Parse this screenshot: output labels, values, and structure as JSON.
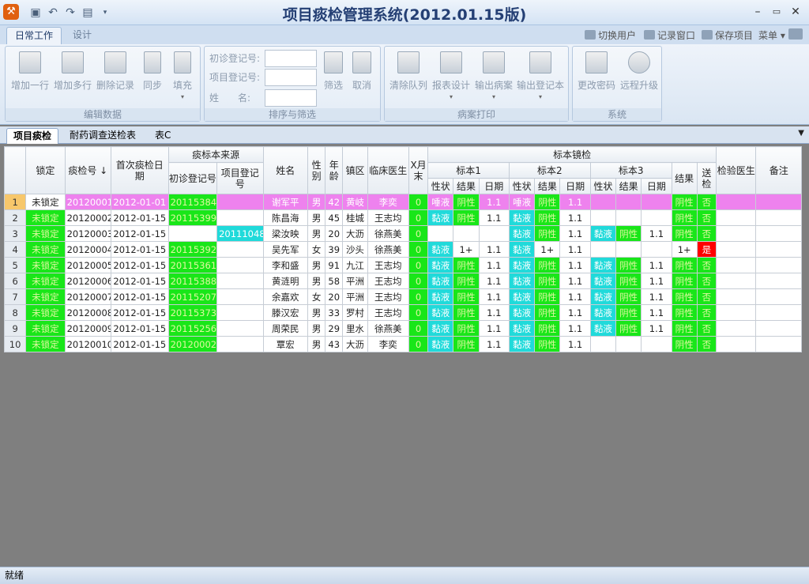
{
  "window": {
    "title": "项目痰检管理系统(2012.01.15版)",
    "app_icon": "tool-icon"
  },
  "ribbon": {
    "tabs": [
      "日常工作",
      "设计"
    ],
    "right_links": [
      "切换用户",
      "记录窗口",
      "保存项目",
      "菜单"
    ],
    "groups": {
      "edit": {
        "title": "编辑数据",
        "buttons": [
          "增加一行",
          "增加多行",
          "删除记录",
          "同步",
          "填充"
        ]
      },
      "filter": {
        "title": "排序与筛选",
        "fields": [
          "初诊登记号:",
          "项目登记号:",
          "姓　　名:"
        ],
        "buttons": [
          "筛选",
          "取消"
        ]
      },
      "print": {
        "title": "病案打印",
        "buttons": [
          "清除队列",
          "报表设计",
          "输出病案",
          "输出登记本"
        ]
      },
      "system": {
        "title": "系统",
        "buttons": [
          "更改密码",
          "远程升级"
        ]
      }
    }
  },
  "doc_tabs": [
    "项目痰检",
    "耐药调查送检表",
    "表C"
  ],
  "grid": {
    "headers": {
      "lock": "锁定",
      "id": "痰检号 ↓",
      "first_date": "首次痰检日期",
      "source": "痰标本来源",
      "src_init": "初诊登记号",
      "src_proj": "项目登记号",
      "name": "姓名",
      "sex": "性别",
      "age": "年龄",
      "town": "镇区",
      "doctor": "临床医生",
      "xray": "X月末",
      "micro": "标本镜检",
      "s1": "标本1",
      "s2": "标本2",
      "s3": "标本3",
      "trait": "性状",
      "result": "结果",
      "date": "日期",
      "final": "结果",
      "send": "送检",
      "lab_doc": "检验医生",
      "note": "备注"
    },
    "rows": [
      {
        "n": "1",
        "lock": "未锁定",
        "id": "20120001",
        "date": "2012-01-01",
        "init": "20115384",
        "proj": "",
        "name": "谢军平",
        "sex": "男",
        "age": "42",
        "town": "黄岐",
        "doctor": "李奕",
        "x": "0",
        "s1": [
          "唾液",
          "阴性",
          "1.1"
        ],
        "s2": [
          "唾液",
          "阴性",
          "1.1"
        ],
        "s3": [
          "",
          "",
          ""
        ],
        "res": "阴性",
        "send": "否"
      },
      {
        "n": "2",
        "lock": "未锁定",
        "id": "20120002",
        "date": "2012-01-15",
        "init": "20115399",
        "proj": "",
        "name": "陈昌海",
        "sex": "男",
        "age": "45",
        "town": "桂城",
        "doctor": "王志均",
        "x": "0",
        "s1": [
          "黏液",
          "阴性",
          "1.1"
        ],
        "s2": [
          "黏液",
          "阴性",
          "1.1"
        ],
        "s3": [
          "",
          "",
          ""
        ],
        "res": "阴性",
        "send": "否"
      },
      {
        "n": "3",
        "lock": "未锁定",
        "id": "20120003",
        "date": "2012-01-15",
        "init": "",
        "proj": "20111048",
        "name": "梁汝映",
        "sex": "男",
        "age": "20",
        "town": "大沥",
        "doctor": "徐燕美",
        "x": "0",
        "s1": [
          "",
          "",
          ""
        ],
        "s2": [
          "黏液",
          "阴性",
          "1.1"
        ],
        "s3": [
          "黏液",
          "阴性",
          "1.1"
        ],
        "res": "阴性",
        "send": "否"
      },
      {
        "n": "4",
        "lock": "未锁定",
        "id": "20120004",
        "date": "2012-01-15",
        "init": "20115392",
        "proj": "",
        "name": "吴先军",
        "sex": "女",
        "age": "39",
        "town": "沙头",
        "doctor": "徐燕美",
        "x": "0",
        "s1": [
          "黏液",
          "1+",
          "1.1"
        ],
        "s2": [
          "黏液",
          "1+",
          "1.1"
        ],
        "s3": [
          "",
          "",
          ""
        ],
        "res": "1+",
        "send": "是"
      },
      {
        "n": "5",
        "lock": "未锁定",
        "id": "20120005",
        "date": "2012-01-15",
        "init": "20115361",
        "proj": "",
        "name": "李和盛",
        "sex": "男",
        "age": "91",
        "town": "九江",
        "doctor": "王志均",
        "x": "0",
        "s1": [
          "黏液",
          "阴性",
          "1.1"
        ],
        "s2": [
          "黏液",
          "阴性",
          "1.1"
        ],
        "s3": [
          "黏液",
          "阴性",
          "1.1"
        ],
        "res": "阴性",
        "send": "否"
      },
      {
        "n": "6",
        "lock": "未锁定",
        "id": "20120006",
        "date": "2012-01-15",
        "init": "20115388",
        "proj": "",
        "name": "黄涟明",
        "sex": "男",
        "age": "58",
        "town": "平洲",
        "doctor": "王志均",
        "x": "0",
        "s1": [
          "黏液",
          "阴性",
          "1.1"
        ],
        "s2": [
          "黏液",
          "阴性",
          "1.1"
        ],
        "s3": [
          "黏液",
          "阴性",
          "1.1"
        ],
        "res": "阴性",
        "send": "否"
      },
      {
        "n": "7",
        "lock": "未锁定",
        "id": "20120007",
        "date": "2012-01-15",
        "init": "20115207",
        "proj": "",
        "name": "余嘉欢",
        "sex": "女",
        "age": "20",
        "town": "平洲",
        "doctor": "王志均",
        "x": "0",
        "s1": [
          "黏液",
          "阴性",
          "1.1"
        ],
        "s2": [
          "黏液",
          "阴性",
          "1.1"
        ],
        "s3": [
          "黏液",
          "阴性",
          "1.1"
        ],
        "res": "阴性",
        "send": "否"
      },
      {
        "n": "8",
        "lock": "未锁定",
        "id": "20120008",
        "date": "2012-01-15",
        "init": "20115373",
        "proj": "",
        "name": "滕汉宏",
        "sex": "男",
        "age": "33",
        "town": "罗村",
        "doctor": "王志均",
        "x": "0",
        "s1": [
          "黏液",
          "阴性",
          "1.1"
        ],
        "s2": [
          "黏液",
          "阴性",
          "1.1"
        ],
        "s3": [
          "黏液",
          "阴性",
          "1.1"
        ],
        "res": "阴性",
        "send": "否"
      },
      {
        "n": "9",
        "lock": "未锁定",
        "id": "20120009",
        "date": "2012-01-15",
        "init": "20115256",
        "proj": "",
        "name": "周荣民",
        "sex": "男",
        "age": "29",
        "town": "里水",
        "doctor": "徐燕美",
        "x": "0",
        "s1": [
          "黏液",
          "阴性",
          "1.1"
        ],
        "s2": [
          "黏液",
          "阴性",
          "1.1"
        ],
        "s3": [
          "黏液",
          "阴性",
          "1.1"
        ],
        "res": "阴性",
        "send": "否"
      },
      {
        "n": "10",
        "lock": "未锁定",
        "id": "20120010",
        "date": "2012-01-15",
        "init": "20120002",
        "proj": "",
        "name": "覃宏",
        "sex": "男",
        "age": "43",
        "town": "大沥",
        "doctor": "李奕",
        "x": "0",
        "s1": [
          "黏液",
          "阴性",
          "1.1"
        ],
        "s2": [
          "黏液",
          "阴性",
          "1.1"
        ],
        "s3": [
          "",
          "",
          ""
        ],
        "res": "阴性",
        "send": "否"
      }
    ]
  },
  "status": {
    "text": "就绪"
  },
  "colors": {
    "green": "#19e619",
    "cyan": "#20dada",
    "magenta": "#ee82ee",
    "red": "#ff0000",
    "teal_row": "#b0e0e6",
    "selected_row": "#f7c76b"
  }
}
